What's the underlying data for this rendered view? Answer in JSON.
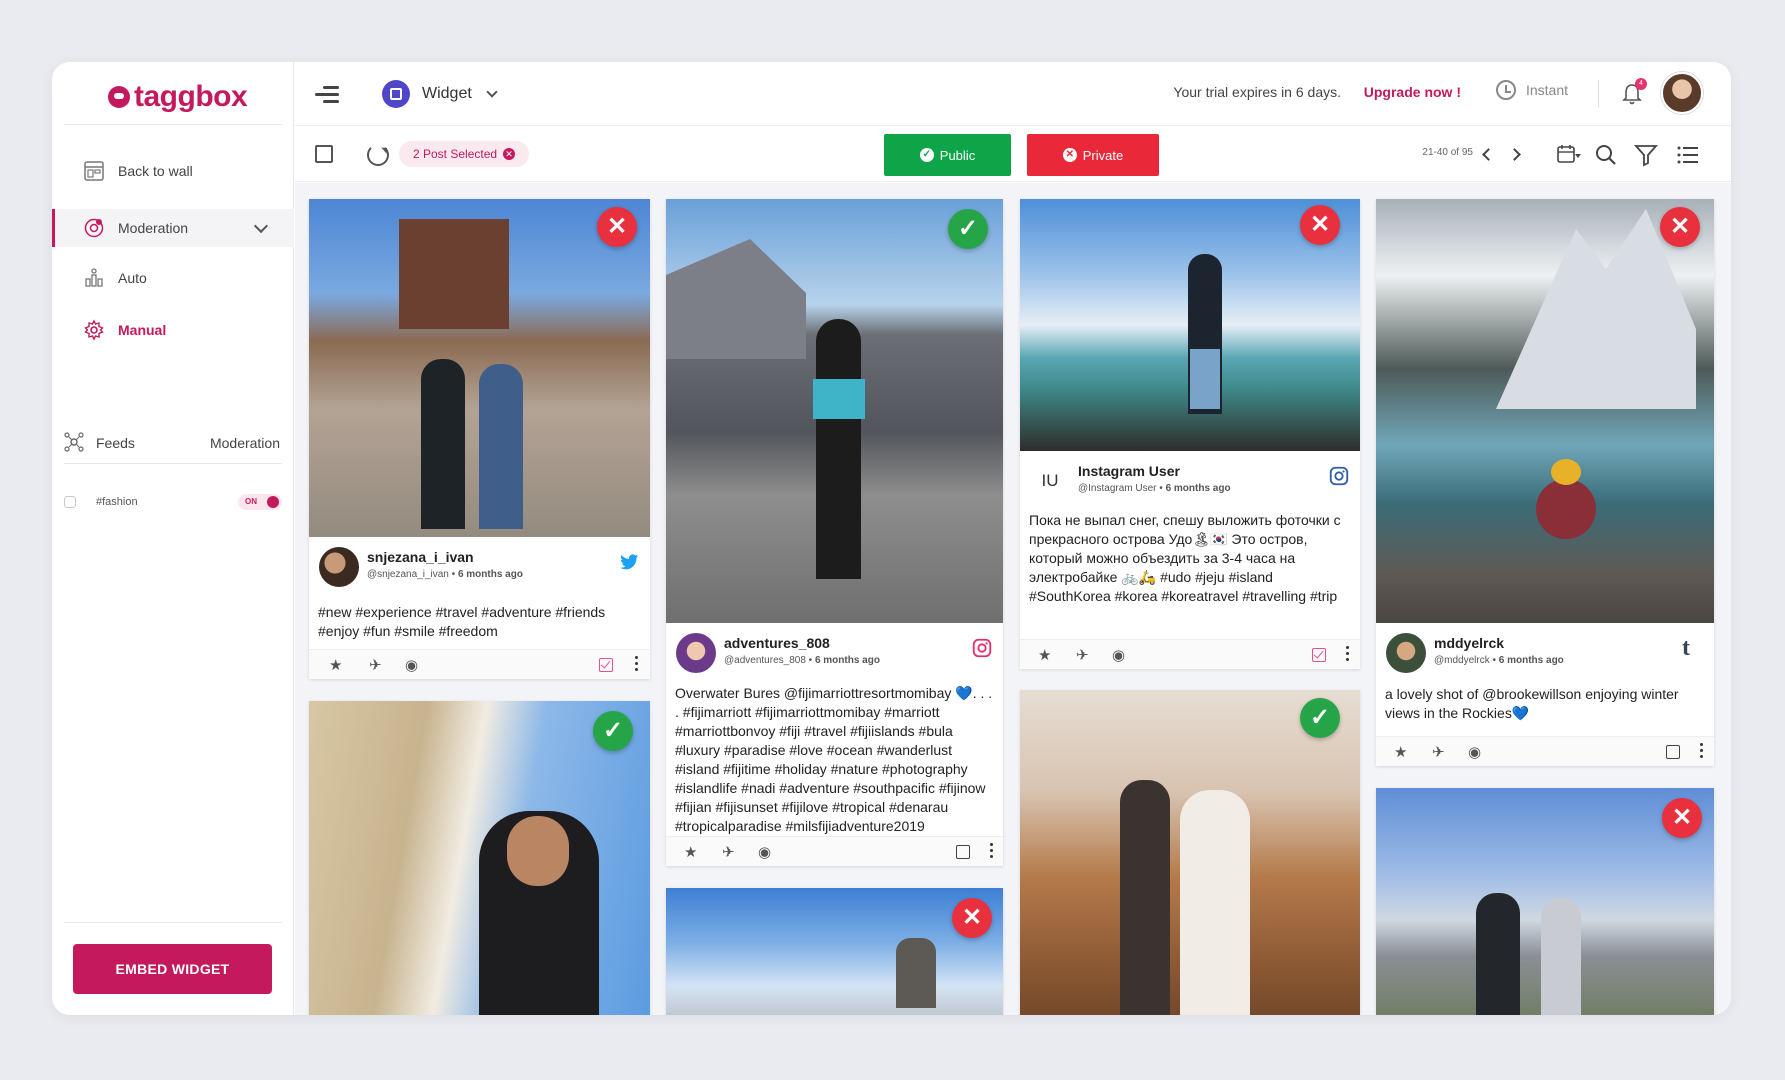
{
  "brand": {
    "name": "taggbox",
    "accent": "#c5195e"
  },
  "sidebar": {
    "items": [
      {
        "label": "Back to wall",
        "icon": "wall-icon"
      },
      {
        "label": "Moderation",
        "icon": "moderation-icon"
      },
      {
        "label": "Auto",
        "icon": "auto-icon"
      },
      {
        "label": "Manual",
        "icon": "gear-icon"
      }
    ],
    "feeds_label": "Feeds",
    "moderation_label": "Moderation",
    "feed": {
      "name": "#fashion",
      "toggle": "ON"
    },
    "embed_button": "EMBED WIDGET"
  },
  "topbar": {
    "widget_label": "Widget",
    "trial_text": "Your trial expires in 6 days.",
    "upgrade_text": "Upgrade now !",
    "instant_label": "Instant",
    "notification_count": "4"
  },
  "toolbar": {
    "selected_text": "2 Post Selected",
    "public_label": "Public",
    "private_label": "Private",
    "pagination": "21-40 of 95"
  },
  "posts": [
    {
      "status": "rejected",
      "author": "snjezana_i_ivan",
      "handle": "@snjezana_i_ivan",
      "time": "6 months ago",
      "network": "twitter-icon",
      "text": "#new #experience #travel #adventure #friends #enjoy #fun #smile #freedom",
      "selected": true
    },
    {
      "status": "approved",
      "author": "adventures_808",
      "handle": "@adventures_808",
      "time": "6 months ago",
      "network": "instagram-icon",
      "text": "Overwater Bures @fijimarriottresortmomibay 💙. . . . #fijimarriott #fijimarriottmomibay #marriott #marriottbonvoy #fiji #travel #fijiislands #bula #luxury #paradise #love #ocean #wanderlust #island #fijitime #holiday #nature #photography #islandlife #nadi #adventure #southpacific #fijinow #fijian #fijisunset #fijilove #tropical #denarau #tropicalparadise #milsfijiadventure2019",
      "selected": false
    },
    {
      "status": "rejected",
      "author": "Instagram User",
      "handle": "@Instagram User",
      "time": "6 months ago",
      "initials": "IU",
      "network": "instagram-icon",
      "text": "Пока не выпал снег, спешу выложить фоточки с прекрасного острова Удо🏝🇰🇷 Это остров, который можно объездить за 3-4 часа на электробайке 🚲🛵 #udo #jeju #island #SouthKorea #korea #koreatravel #travelling #trip",
      "selected": true
    },
    {
      "status": "rejected",
      "author": "mddyelrck",
      "handle": "@mddyelrck",
      "time": "6 months ago",
      "network": "tumblr-icon",
      "text": "a lovely shot of @brookewillson enjoying winter views in the Rockies💙",
      "selected": false
    },
    {
      "status": "approved"
    },
    {
      "status": "rejected"
    },
    {
      "status": "approved"
    },
    {
      "status": "rejected"
    }
  ]
}
